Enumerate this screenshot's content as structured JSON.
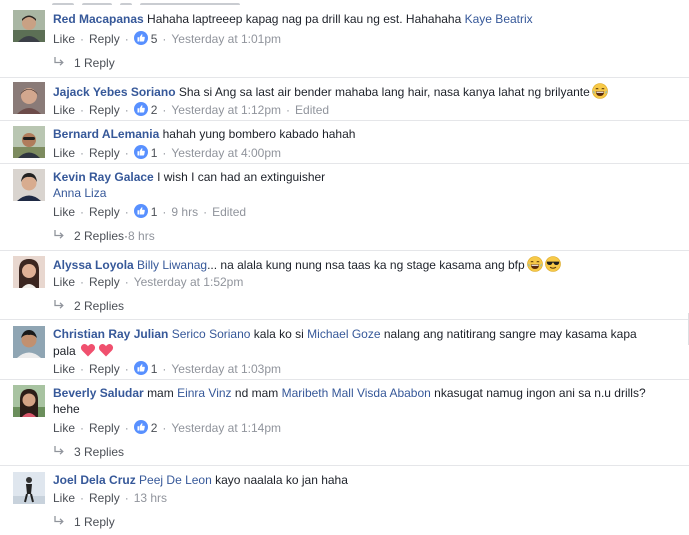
{
  "ui": {
    "like": "Like",
    "reply": "Reply",
    "sep": "·"
  },
  "colors": {
    "link": "#365899",
    "meta": "#90949c",
    "action": "#4b4f56",
    "like_badge": "#5890ff",
    "heart": "#f0506e"
  },
  "comments": [
    {
      "author": "Red Macapanas",
      "text": "Hahaha laptreeep kapag nag pa drill kau ng est. Hahahaha",
      "tag": "Kaye Beatrix",
      "likes": "5",
      "time": "Yesterday at 1:01pm",
      "replies": "1 Reply"
    },
    {
      "author": "Jajack Yebes Soriano",
      "text": "Sha si Ang sa last air bender mahaba lang hair, nasa kanya lahat ng brilyante",
      "emoji": "laughing-emoji",
      "likes": "2",
      "time": "Yesterday at 1:12pm",
      "edited": "Edited"
    },
    {
      "author": "Bernard ALemania",
      "text": "hahah yung bombero kabado hahah",
      "likes": "1",
      "time": "Yesterday at 4:00pm"
    },
    {
      "author": "Kevin Ray Galace",
      "text": "I wish I can had an extinguisher",
      "tag": "Anna Liza",
      "likes": "1",
      "time": "9 hrs",
      "edited": "Edited",
      "replies": "2 Replies",
      "replies_time": "8 hrs"
    },
    {
      "author": "Alyssa Loyola",
      "tag": "Billy Liwanag",
      "text": "... na alala kung nung nsa taas ka ng stage kasama ang bfp",
      "time": "Yesterday at 1:52pm",
      "replies": "2 Replies"
    },
    {
      "author": "Christian Ray Julian",
      "tag": "Serico Soriano",
      "text_a": "kala ko si",
      "tag2": "Michael Goze",
      "text_b": "nalang ang natitirang sangre may kasama kapa",
      "text_c": "pala",
      "likes": "1",
      "time": "Yesterday at 1:03pm"
    },
    {
      "author": "Beverly Saludar",
      "text_a": "mam",
      "tag": "Einra Vinz",
      "text_b": "nd mam",
      "tag2": "Maribeth Mall Visda Ababon",
      "text_c": "nkasugat namug ingon ani sa n.u drills?",
      "text_d": "hehe",
      "likes": "2",
      "time": "Yesterday at 1:14pm",
      "replies": "3 Replies"
    },
    {
      "author": "Joel Dela Cruz",
      "tag": "Peej De Leon",
      "text": "kayo naalala ko jan haha",
      "time": "13 hrs",
      "replies": "1 Reply"
    }
  ]
}
